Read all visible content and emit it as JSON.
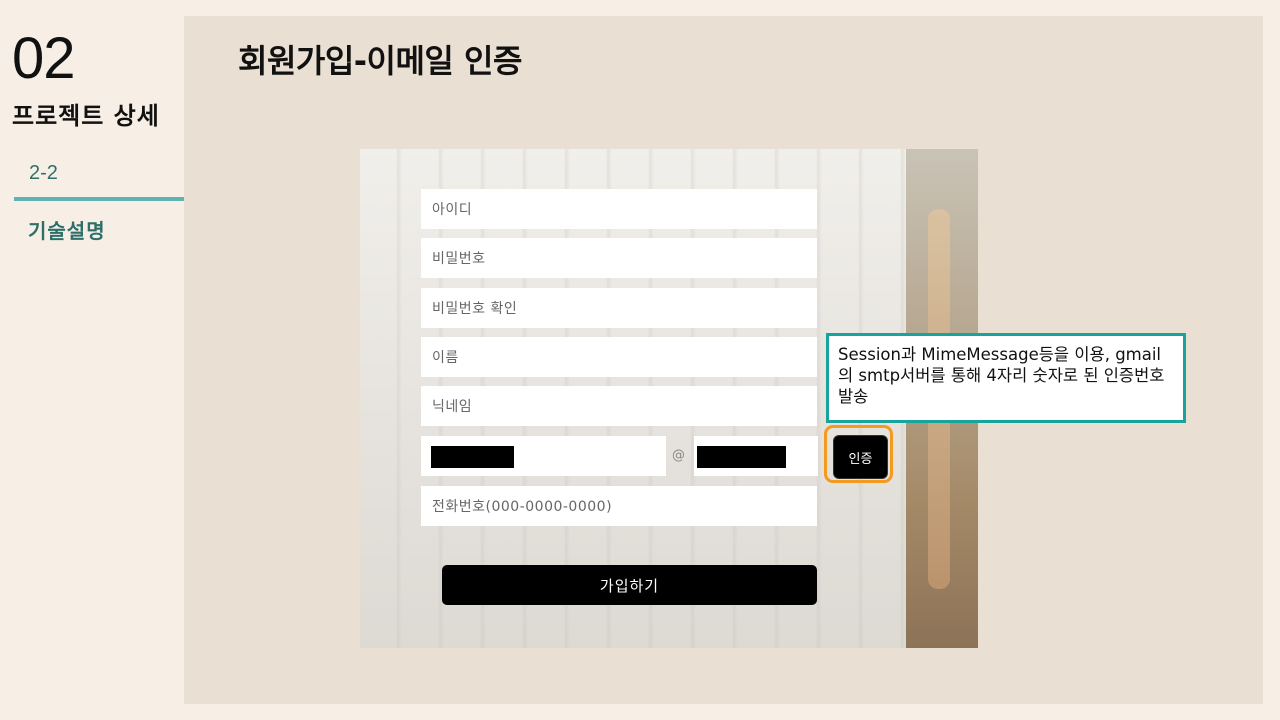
{
  "sidebar": {
    "section_number": "02",
    "section_title": "프로젝트 상세",
    "sub_number": "2-2",
    "sub_title": "기술설명"
  },
  "slide": {
    "title": "회원가입-이메일 인증"
  },
  "form": {
    "fields": [
      {
        "placeholder": "아이디"
      },
      {
        "placeholder": "비밀번호"
      },
      {
        "placeholder": "비밀번호 확인"
      },
      {
        "placeholder": "이름"
      },
      {
        "placeholder": "닉네임"
      }
    ],
    "email_at": "@",
    "verify_label": "인증",
    "phone_placeholder": "전화번호(000-0000-0000)",
    "submit_label": "가입하기"
  },
  "callout": {
    "text": "Session과 MimeMessage등을 이용, gmail의 smtp서버를 통해 4자리 숫자로 된 인증번호 발송"
  },
  "colors": {
    "accent_teal": "#18a39c",
    "highlight_orange": "#f39a1f",
    "sub_text": "#2e6f6a"
  }
}
